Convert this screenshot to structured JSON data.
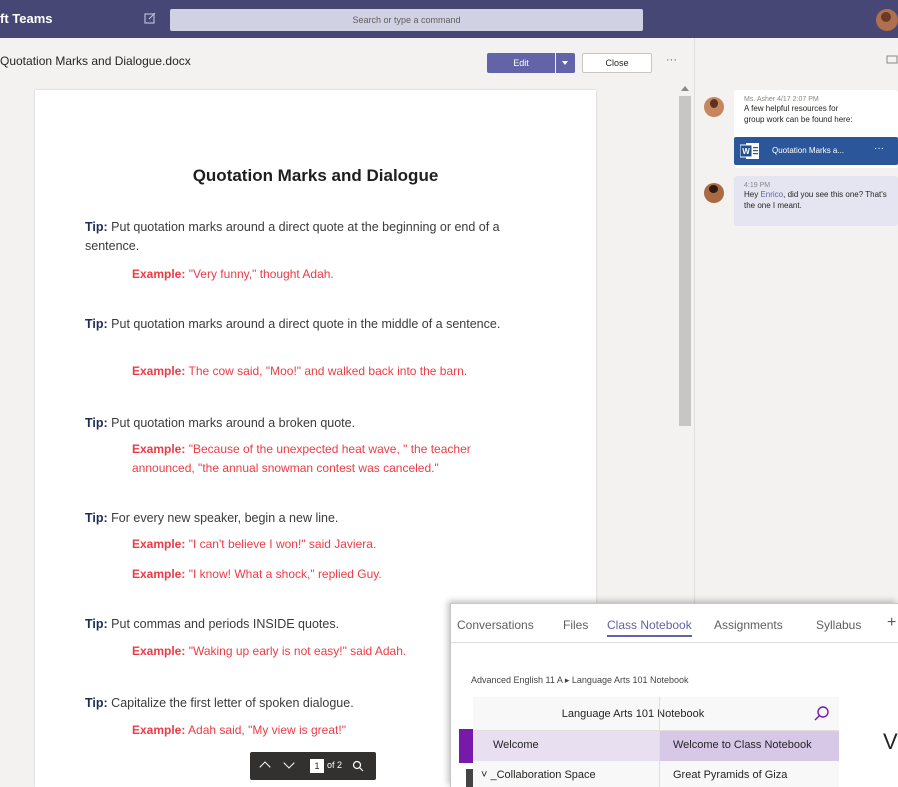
{
  "app": {
    "title": "ft Teams"
  },
  "search": {
    "placeholder": "Search or type a command"
  },
  "file": {
    "name": "Quotation Marks and Dialogue.docx",
    "edit_label": "Edit",
    "close_label": "Close",
    "more": "···"
  },
  "document": {
    "title": "Quotation Marks and Dialogue",
    "tips": [
      {
        "label": "Tip:",
        "text": "Put quotation marks around a direct quote at the beginning or end of a sentence."
      },
      {
        "label": "Tip:",
        "text": "Put quotation marks around a direct quote in the middle of a sentence."
      },
      {
        "label": "Tip:",
        "text": "Put quotation marks around a broken quote."
      },
      {
        "label": "Tip:",
        "text": "For every new speaker, begin a new line."
      },
      {
        "label": "Tip:",
        "text": "Put commas and periods INSIDE quotes."
      },
      {
        "label": "Tip:",
        "text": "Capitalize the first letter of spoken dialogue."
      }
    ],
    "examples": [
      {
        "label": "Example:",
        "text": "\"Very funny,\" thought Adah."
      },
      {
        "label": "Example:",
        "text": "The cow said, \"Moo!\" and walked back into the barn."
      },
      {
        "label": "Example:",
        "text": "\"Because of the unexpected heat wave, \" the teacher announced, \"the annual snowman contest was canceled.\""
      },
      {
        "label": "Example:",
        "text": "\"I can't believe I won!\" said Javiera."
      },
      {
        "label": "Example:",
        "text": "\"I know! What a shock,\" replied Guy."
      },
      {
        "label": "Example:",
        "text": "\"Waking up early is not easy!\" said Adah."
      },
      {
        "label": "Example:",
        "text": "Adah said, \"My view is great!\""
      }
    ]
  },
  "pager": {
    "current": "1",
    "total": "of 2"
  },
  "chat": {
    "messages": [
      {
        "meta": "Ms. Asher  4/17 2:07 PM",
        "text": "A few helpful resources for group work can be found here:"
      },
      {
        "meta": "4:19 PM",
        "text_pre": "Hey ",
        "mention": "Enrico",
        "text_post": ", did you see this one? That's the one I meant."
      }
    ],
    "attachment": {
      "name": "Quotation Marks a...",
      "more": "···"
    }
  },
  "overlay": {
    "tabs": [
      {
        "label": "Conversations"
      },
      {
        "label": "Files"
      },
      {
        "label": "Class Notebook"
      },
      {
        "label": "Assignments"
      },
      {
        "label": "Syllabus"
      }
    ],
    "add": "+",
    "breadcrumb": "Advanced English 11 A  ▸  Language Arts 101 Notebook",
    "notebook_title": "Language Arts 101 Notebook",
    "sections": [
      {
        "section": "Welcome",
        "page": "Welcome to Class Notebook"
      },
      {
        "section": "˅ _Collaboration Space",
        "page": "Great Pyramids of Giza"
      }
    ],
    "page_letter": "V"
  },
  "colors": {
    "teams_header": "#464775",
    "accent": "#6264a7",
    "example_red": "#ee3b45",
    "word_blue": "#2b579a"
  }
}
